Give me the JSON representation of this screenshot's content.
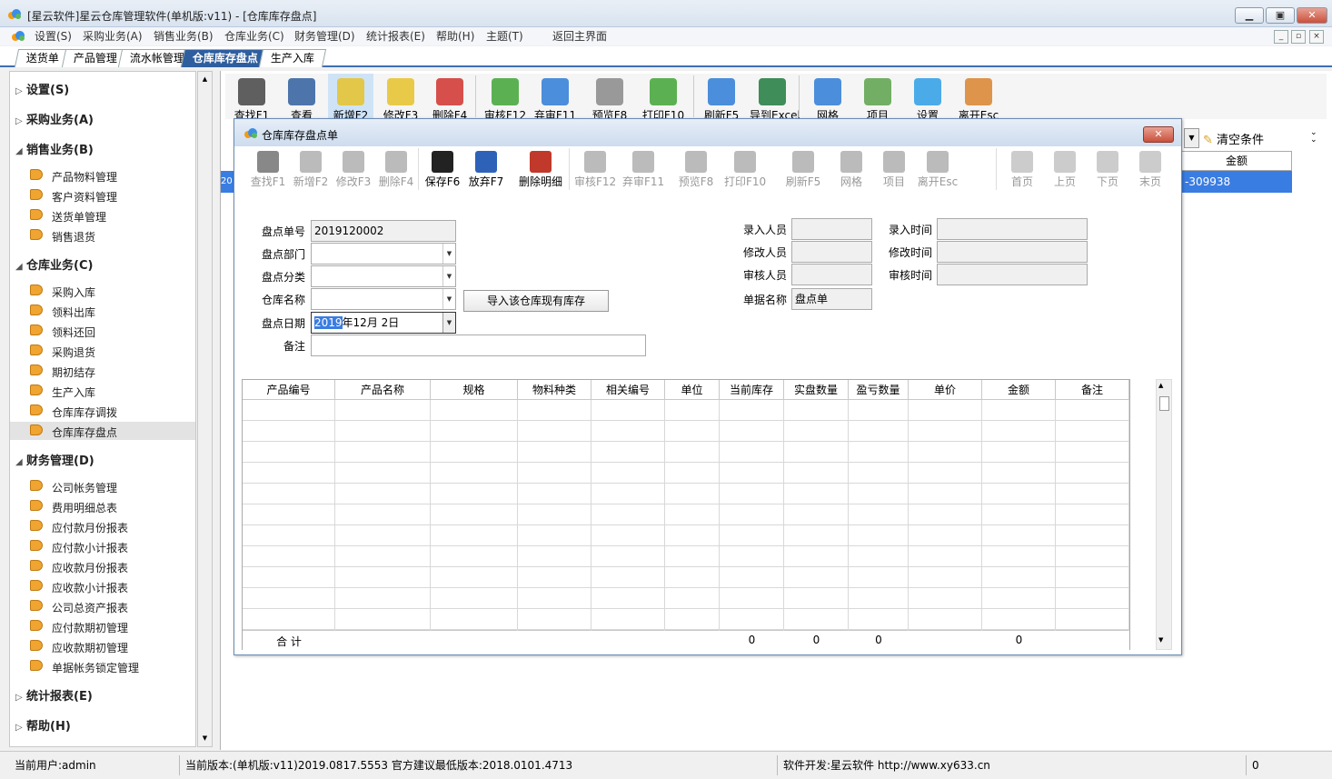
{
  "window": {
    "title": "[星云软件]星云仓库管理软件(单机版:v11) - [仓库库存盘点]"
  },
  "menu": [
    "设置(S)",
    "采购业务(A)",
    "销售业务(B)",
    "仓库业务(C)",
    "财务管理(D)",
    "统计报表(E)",
    "帮助(H)",
    "主题(T)",
    "返回主界面"
  ],
  "tabs": [
    "送货单",
    "产品管理",
    "流水帐管理",
    "仓库库存盘点",
    "生产入库"
  ],
  "sidebar": {
    "groups": [
      {
        "label": "设置(S)",
        "items": []
      },
      {
        "label": "采购业务(A)",
        "items": []
      },
      {
        "label": "销售业务(B)",
        "items": [
          "产品物料管理",
          "客户资料管理",
          "送货单管理",
          "销售退货"
        ]
      },
      {
        "label": "仓库业务(C)",
        "items": [
          "采购入库",
          "领料出库",
          "领料还回",
          "采购退货",
          "期初结存",
          "生产入库",
          "仓库库存调拨",
          "仓库库存盘点"
        ]
      },
      {
        "label": "财务管理(D)",
        "items": [
          "公司帐务管理",
          "费用明细总表",
          "应付款月份报表",
          "应付款小计报表",
          "应收款月份报表",
          "应收款小计报表",
          "公司总资产报表",
          "应付款期初管理",
          "应收款期初管理",
          "单据帐务锁定管理"
        ]
      },
      {
        "label": "统计报表(E)",
        "items": []
      },
      {
        "label": "帮助(H)",
        "items": []
      }
    ]
  },
  "toolbar": [
    "查找F1",
    "查看",
    "新增F2",
    "修改F3",
    "删除F4",
    "审核F12",
    "弃审F11",
    "预览F8",
    "打印F10",
    "刷新F5",
    "导到Excel",
    "网格",
    "项目",
    "设置",
    "离开Esc"
  ],
  "background": {
    "clear_filter": "清空条件",
    "amount_header": "金额",
    "amount_value": "-309938",
    "row_prefix": "20"
  },
  "dialog": {
    "title": "仓库库存盘点单",
    "toolbar": [
      "查找F1",
      "新增F2",
      "修改F3",
      "删除F4",
      "保存F6",
      "放弃F7",
      "删除明细",
      "审核F12",
      "弃审F11",
      "预览F8",
      "打印F10",
      "刷新F5",
      "网格",
      "项目",
      "离开Esc",
      "首页",
      "上页",
      "下页",
      "末页"
    ],
    "form": {
      "no_label": "盘点单号",
      "no_value": "2019120002",
      "dept_label": "盘点部门",
      "dept_value": "",
      "cat_label": "盘点分类",
      "cat_value": "",
      "wh_label": "仓库名称",
      "wh_value": "",
      "import_button": "导入该仓库现有库存",
      "date_label": "盘点日期",
      "date_sel": "2019",
      "date_rest": "年12月  2日",
      "remark_label": "备注",
      "remark_value": "",
      "entry_user_label": "录入人员",
      "entry_user": "",
      "entry_time_label": "录入时间",
      "entry_time": "",
      "mod_user_label": "修改人员",
      "mod_user": "",
      "mod_time_label": "修改时间",
      "mod_time": "",
      "audit_user_label": "审核人员",
      "audit_user": "",
      "audit_time_label": "审核时间",
      "audit_time": "",
      "docname_label": "单据名称",
      "docname_value": "盘点单"
    },
    "grid": {
      "columns": [
        "产品编号",
        "产品名称",
        "规格",
        "物料种类",
        "相关编号",
        "单位",
        "当前库存",
        "实盘数量",
        "盈亏数量",
        "单价",
        "金额",
        "备注"
      ],
      "footer": {
        "label": "合 计",
        "current_stock": "0",
        "actual_qty": "0",
        "diff_qty": "0",
        "amount": "0"
      }
    }
  },
  "status": {
    "user": "当前用户:admin",
    "version": "当前版本:(单机版:v11)2019.0817.5553 官方建议最低版本:2018.0101.4713",
    "dev": "软件开发:星云软件 http://www.xy633.cn",
    "count": "0"
  }
}
